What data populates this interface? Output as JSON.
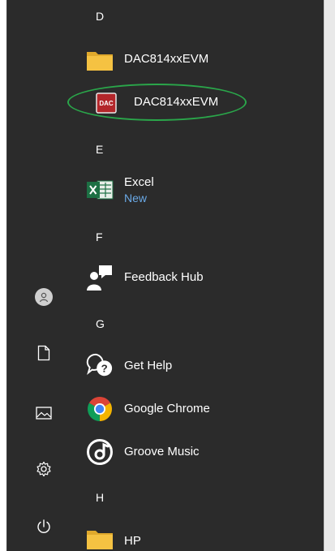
{
  "rail": {
    "items": [
      {
        "name": "account",
        "icon": "user-avatar-icon"
      },
      {
        "name": "documents",
        "icon": "document-icon"
      },
      {
        "name": "pictures",
        "icon": "pictures-icon"
      },
      {
        "name": "settings",
        "icon": "gear-icon"
      },
      {
        "name": "power",
        "icon": "power-icon"
      }
    ]
  },
  "apps": {
    "letter_d": "D",
    "dac_folder": {
      "label": "DAC814xxEVM",
      "icon": "folder-icon"
    },
    "dac_app": {
      "label": "DAC814xxEVM",
      "icon_text": "DAC",
      "icon": "dac-app-icon",
      "annotation_color": "#2aa64a"
    },
    "letter_e": "E",
    "excel": {
      "label": "Excel",
      "badge": "New",
      "icon": "excel-icon"
    },
    "letter_f": "F",
    "feedback_hub": {
      "label": "Feedback Hub",
      "icon": "feedback-hub-icon"
    },
    "letter_g": "G",
    "get_help": {
      "label": "Get Help",
      "icon": "get-help-icon"
    },
    "google_chrome": {
      "label": "Google Chrome",
      "icon": "chrome-icon"
    },
    "groove_music": {
      "label": "Groove Music",
      "icon": "groove-music-icon"
    },
    "letter_h": "H",
    "hp": {
      "label": "HP",
      "icon": "folder-icon"
    }
  },
  "colors": {
    "background": "#2b2b2b",
    "text": "#ffffff",
    "accent_new": "#6aa9e6",
    "folder": "#f5c242",
    "excel_green": "#1d7044",
    "highlight_ring": "#2aa64a"
  }
}
